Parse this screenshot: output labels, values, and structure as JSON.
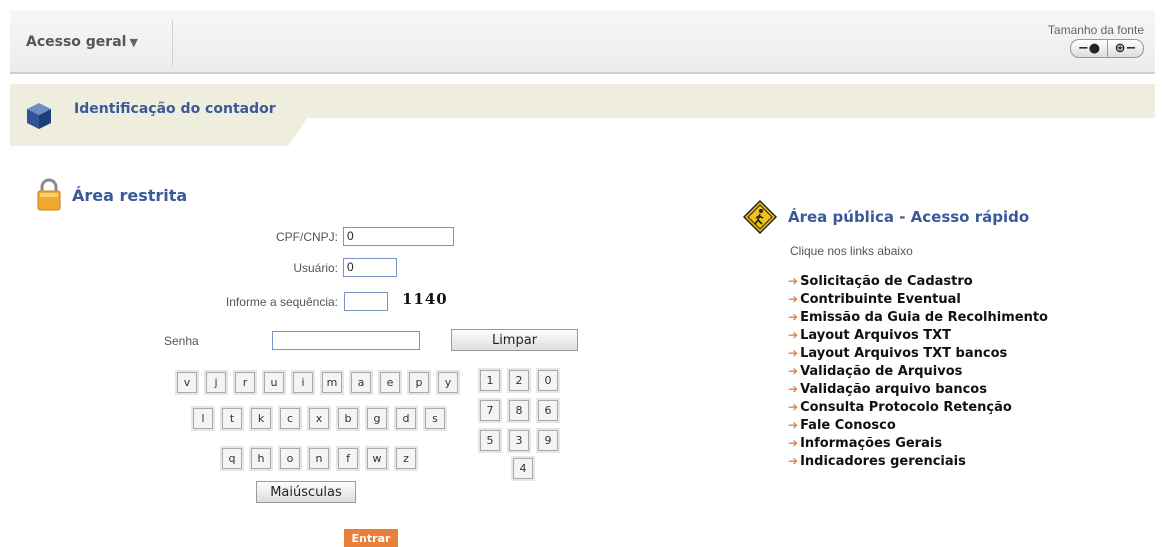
{
  "topbar": {
    "access_label": "Acesso geral",
    "font_size_label": "Tamanho da fonte",
    "font_decrease_icon": "minus-circle-icon",
    "font_increase_icon": "plus-circle-icon"
  },
  "banner": {
    "title": "Identificação do contador"
  },
  "restricted": {
    "title": "Área restrita",
    "cpf_label": "CPF/CNPJ:",
    "cpf_value": "0",
    "user_label": "Usuário:",
    "user_value": "0",
    "sequence_label": "Informe a sequência:",
    "sequence_value": "",
    "captcha": "1140",
    "password_label": "Senha",
    "password_value": "",
    "clear_button": "Limpar",
    "caps_button": "Maiúsculas",
    "submit_button": "Entrar"
  },
  "keyboard": {
    "row1": [
      "v",
      "j",
      "r",
      "u",
      "i",
      "m",
      "a",
      "e",
      "p",
      "y"
    ],
    "row2": [
      "l",
      "t",
      "k",
      "c",
      "x",
      "b",
      "g",
      "d",
      "s"
    ],
    "row3": [
      "q",
      "h",
      "o",
      "n",
      "f",
      "w",
      "z"
    ],
    "numpad": [
      "1",
      "2",
      "0",
      "7",
      "8",
      "6",
      "5",
      "3",
      "9",
      "4"
    ]
  },
  "public": {
    "title": "Área pública - Acesso rápido",
    "subtitle": "Clique nos links abaixo",
    "links": [
      "Solicitação de Cadastro",
      "Contribuinte Eventual",
      "Emissão da Guia de Recolhimento",
      "Layout Arquivos TXT",
      "Layout Arquivos TXT bancos",
      "Validação de Arquivos",
      "Validação arquivo bancos",
      "Consulta Protocolo Retenção",
      "Fale Conosco",
      "Informações Gerais",
      "Indicadores gerenciais"
    ]
  },
  "colors": {
    "accent": "#3b5998",
    "orange": "#e8803a",
    "banner": "#efeede"
  }
}
